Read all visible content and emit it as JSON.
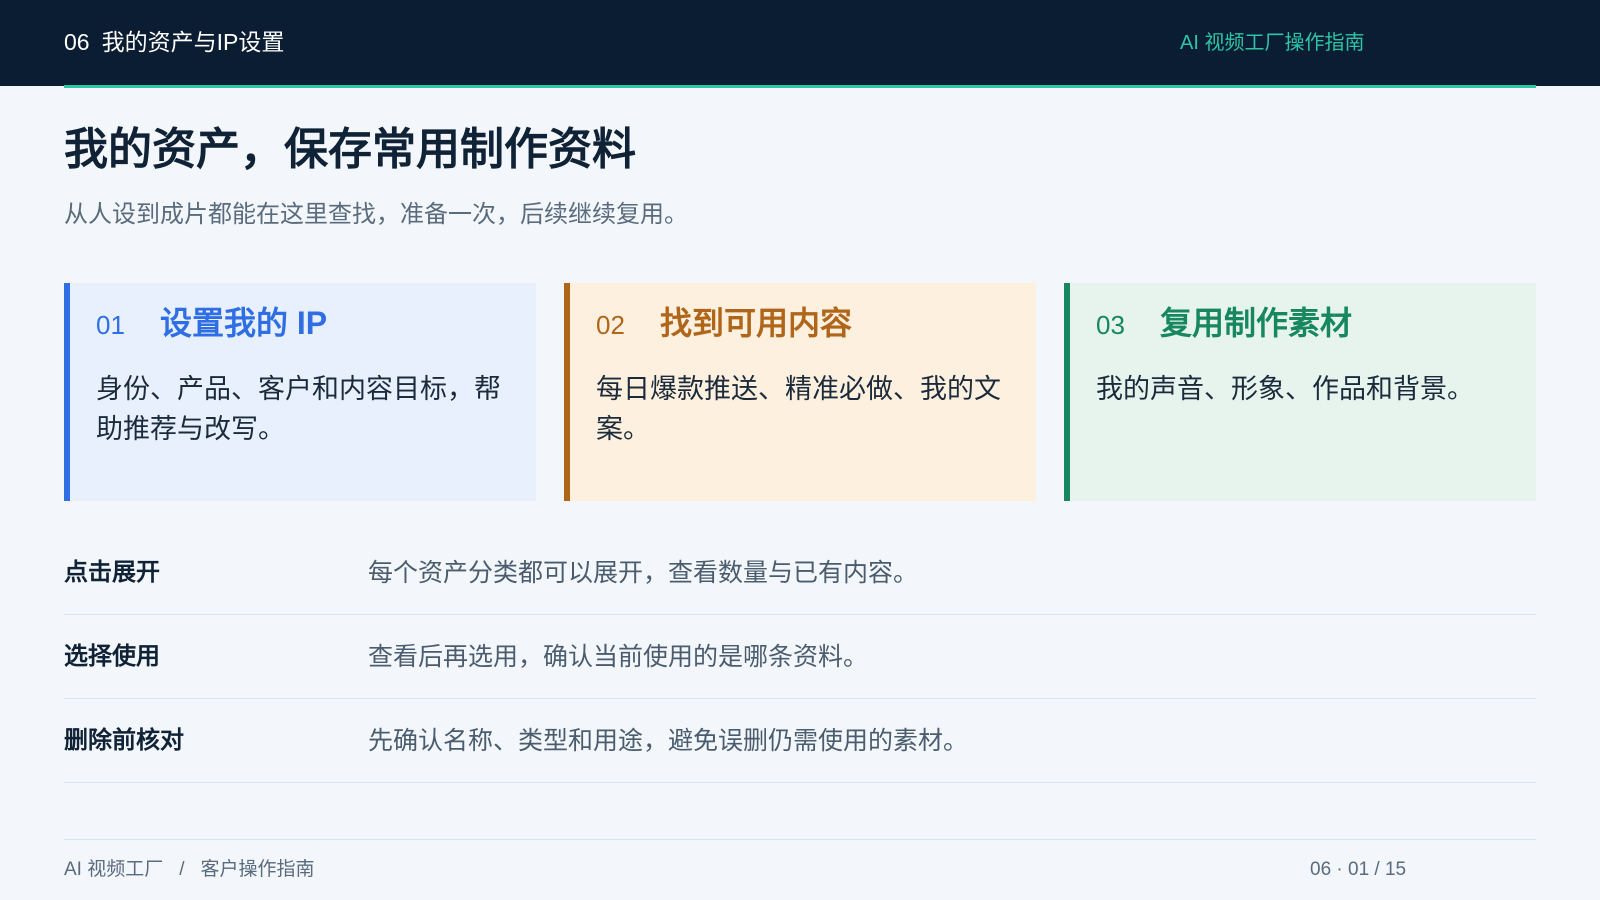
{
  "header": {
    "section_number": "06",
    "section_title": "我的资产与IP设置",
    "guide_title": "AI 视频工厂操作指南",
    "accent_color": "#2ec4a6",
    "background_color": "#0b1d33"
  },
  "page": {
    "title": "我的资产，保存常用制作资料",
    "subtitle": "从人设到成片都能在这里查找，准备一次，后续继续复用。"
  },
  "cards": [
    {
      "number": "01",
      "title": "设置我的 IP",
      "description": "身份、产品、客户和内容目标，帮助推荐与改写。",
      "color": "#2f6fe3"
    },
    {
      "number": "02",
      "title": "找到可用内容",
      "description": "每日爆款推送、精准必做、我的文案。",
      "color": "#b0661a"
    },
    {
      "number": "03",
      "title": "复用制作素材",
      "description": "我的声音、形象、作品和背景。",
      "color": "#16875f"
    }
  ],
  "rows": [
    {
      "label": "点击展开",
      "text": "每个资产分类都可以展开，查看数量与已有内容。"
    },
    {
      "label": "选择使用",
      "text": "查看后再选用，确认当前使用的是哪条资料。"
    },
    {
      "label": "删除前核对",
      "text": "先确认名称、类型和用途，避免误删仍需使用的素材。"
    }
  ],
  "footer": {
    "brand": "AI 视频工厂",
    "separator": "/",
    "guide": "客户操作指南",
    "page_indicator": "06 · 01 / 15"
  }
}
